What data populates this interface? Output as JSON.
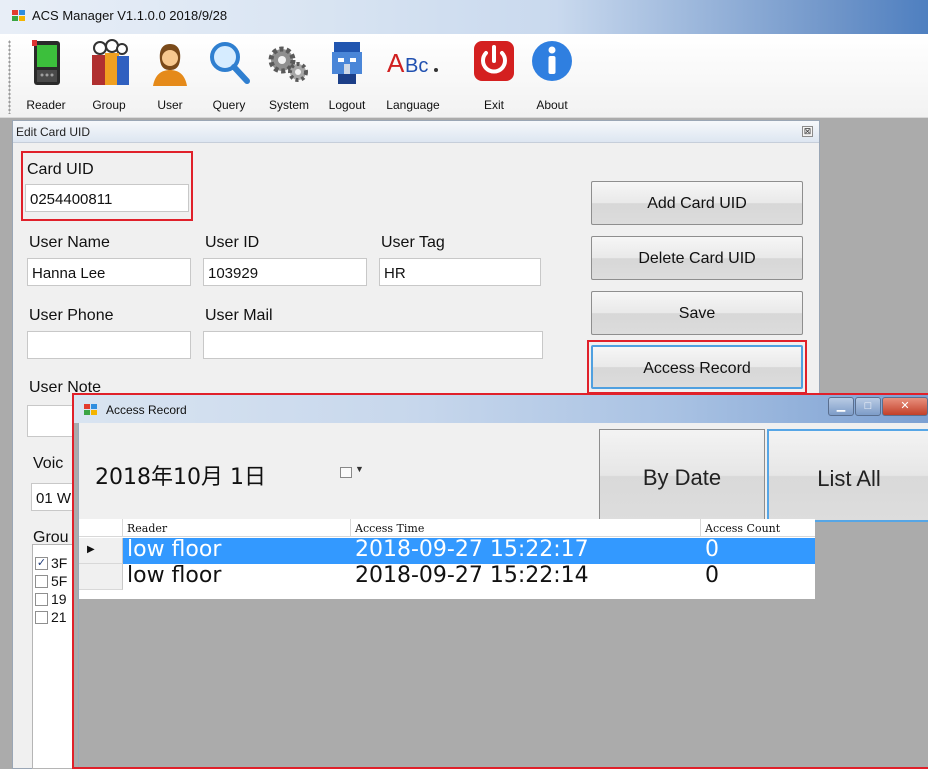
{
  "app": {
    "title": "ACS Manager V1.1.0.0 2018/9/28"
  },
  "toolbar": [
    {
      "name": "reader",
      "label": "Reader",
      "icon": "reader-device-icon"
    },
    {
      "name": "group",
      "label": "Group",
      "icon": "group-people-icon"
    },
    {
      "name": "user",
      "label": "User",
      "icon": "user-person-icon"
    },
    {
      "name": "query",
      "label": "Query",
      "icon": "magnifier-icon"
    },
    {
      "name": "system",
      "label": "System",
      "icon": "gears-icon"
    },
    {
      "name": "logout",
      "label": "Logout",
      "icon": "robot-head-icon"
    },
    {
      "name": "language",
      "label": "Language",
      "icon": "abc-icon"
    },
    {
      "name": "exit",
      "label": "Exit",
      "icon": "power-icon"
    },
    {
      "name": "about",
      "label": "About",
      "icon": "info-icon"
    }
  ],
  "edit_card": {
    "title": "Edit Card UID",
    "close_glyph": "⊠",
    "card_uid_label": "Card UID",
    "card_uid_value": "0254400811",
    "user_name_label": "User Name",
    "user_name_value": "Hanna Lee",
    "user_id_label": "User ID",
    "user_id_value": "103929",
    "user_tag_label": "User Tag",
    "user_tag_value": "HR",
    "user_phone_label": "User Phone",
    "user_phone_value": "",
    "user_mail_label": "User Mail",
    "user_mail_value": "",
    "user_note_label": "User Note",
    "voice_label_partial": "Voic",
    "voice_value_partial": "01 W",
    "group_label_partial": "Grou",
    "groups": [
      {
        "text": "3F",
        "checked": true
      },
      {
        "text": "5F",
        "checked": false
      },
      {
        "text": "19",
        "checked": false
      },
      {
        "text": "21",
        "checked": false
      }
    ],
    "buttons": {
      "add": "Add Card UID",
      "delete": "Delete Card UID",
      "save": "Save",
      "access_record": "Access Record"
    }
  },
  "access_record": {
    "title": "Access Record",
    "date_value": "2018年10月  1日",
    "by_date_label": "By Date",
    "list_all_label": "List All",
    "columns": [
      "Reader",
      "Access Time",
      "Access Count"
    ],
    "rows": [
      {
        "reader": "low floor",
        "time": "2018-09-27 15:22:17",
        "count": "0",
        "selected": true
      },
      {
        "reader": "low floor",
        "time": "2018-09-27 15:22:14",
        "count": "0",
        "selected": false
      }
    ]
  },
  "colors": {
    "highlight_red": "#e0202a",
    "selection_blue": "#3399ff"
  }
}
